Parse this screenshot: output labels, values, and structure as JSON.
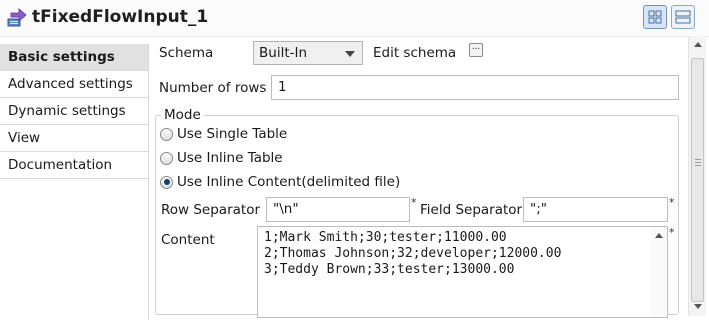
{
  "component": {
    "title": "tFixedFlowInput_1"
  },
  "sidebar": {
    "items": [
      {
        "label": "Basic settings",
        "active": true
      },
      {
        "label": "Advanced settings",
        "active": false
      },
      {
        "label": "Dynamic settings",
        "active": false
      },
      {
        "label": "View",
        "active": false
      },
      {
        "label": "Documentation",
        "active": false
      }
    ]
  },
  "schema": {
    "label": "Schema",
    "selected": "Built-In",
    "edit_label": "Edit schema",
    "edit_button": "..."
  },
  "rows": {
    "label": "Number of rows",
    "value": "1"
  },
  "mode": {
    "title": "Mode",
    "options": [
      {
        "label": "Use Single Table",
        "checked": false
      },
      {
        "label": "Use Inline Table",
        "checked": false
      },
      {
        "label": "Use Inline Content(delimited file)",
        "checked": true
      }
    ]
  },
  "separators": {
    "row_label": "Row Separator",
    "row_value": "\"\\n\"",
    "field_label": "Field Separator",
    "field_value": "\";\"",
    "required_mark": "*"
  },
  "content": {
    "label": "Content",
    "lines": [
      "1;Mark Smith;30;tester;11000.00",
      "2;Thomas Johnson;32;developer;12000.00",
      "3;Teddy Brown;33;tester;13000.00"
    ]
  }
}
